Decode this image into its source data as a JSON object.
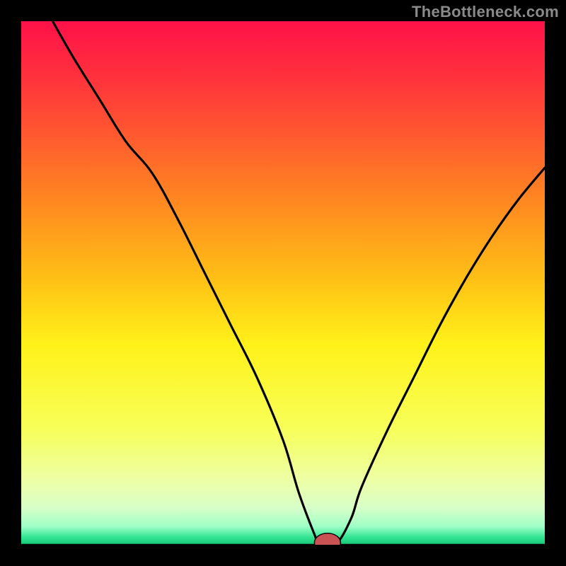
{
  "attribution": "TheBottleneck.com",
  "colors": {
    "black": "#000000",
    "curve": "#000000",
    "gradient_stops": [
      {
        "offset": 0.0,
        "color": "#ff1149"
      },
      {
        "offset": 0.1,
        "color": "#ff2f3d"
      },
      {
        "offset": 0.22,
        "color": "#ff5a2f"
      },
      {
        "offset": 0.35,
        "color": "#ff8a20"
      },
      {
        "offset": 0.5,
        "color": "#ffc315"
      },
      {
        "offset": 0.62,
        "color": "#fff21a"
      },
      {
        "offset": 0.78,
        "color": "#f7ff5a"
      },
      {
        "offset": 0.88,
        "color": "#ecffa8"
      },
      {
        "offset": 0.93,
        "color": "#d7ffc8"
      },
      {
        "offset": 0.965,
        "color": "#9effc7"
      },
      {
        "offset": 0.985,
        "color": "#35e593"
      },
      {
        "offset": 1.0,
        "color": "#14c877"
      }
    ],
    "marker_fill": "#c95353",
    "marker_stroke": "#000000"
  },
  "chart_data": {
    "type": "line",
    "title": "",
    "xlabel": "",
    "ylabel": "",
    "xlim": [
      0,
      100
    ],
    "ylim": [
      0,
      100
    ],
    "series": [
      {
        "name": "bottleneck-curve",
        "x": [
          6,
          10,
          15,
          20,
          25,
          30,
          35,
          40,
          45,
          50,
          53,
          56,
          57,
          60,
          63,
          65,
          70,
          75,
          80,
          85,
          90,
          95,
          100
        ],
        "y": [
          100,
          93,
          85,
          77,
          71,
          62,
          52,
          42,
          32,
          20,
          10,
          2,
          0,
          0,
          5,
          11,
          22,
          32,
          42,
          51,
          59,
          66,
          72
        ]
      }
    ],
    "floor_y": 0,
    "marker": {
      "x": 58.5,
      "y": 0,
      "rx": 2.5,
      "ry": 1.0
    }
  }
}
